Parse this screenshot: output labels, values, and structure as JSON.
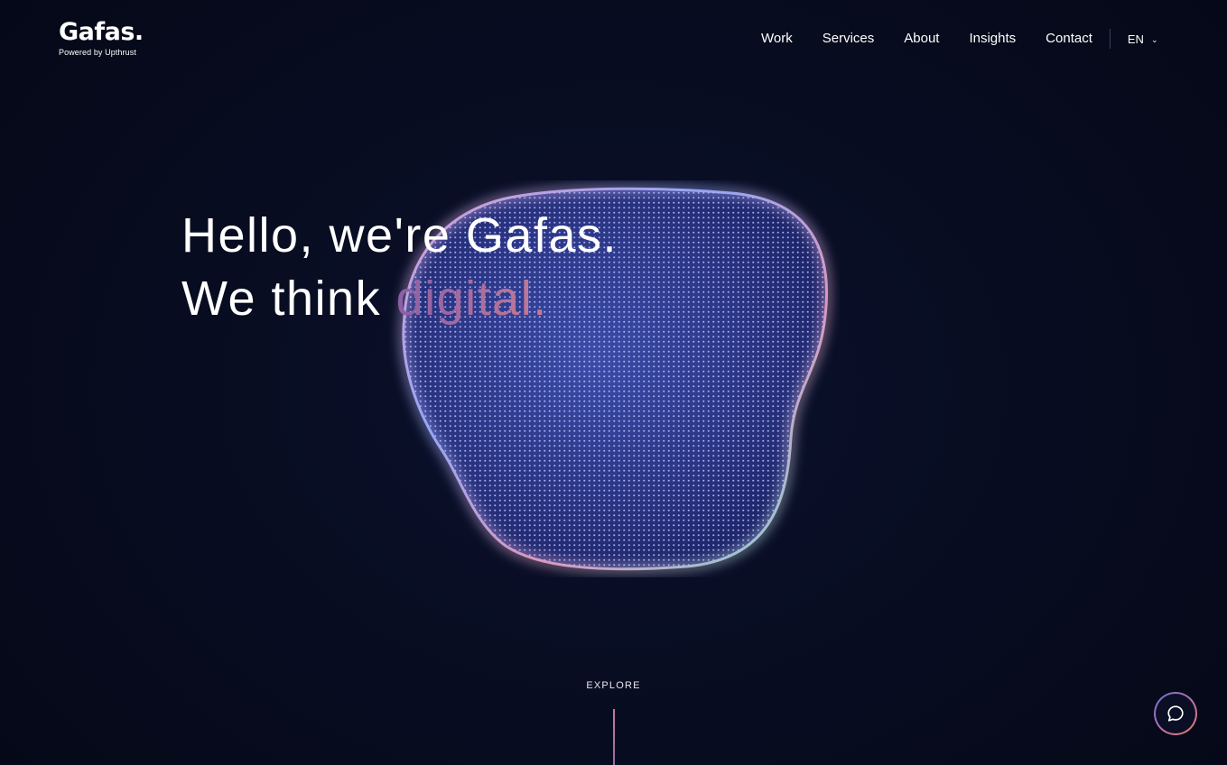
{
  "brand": {
    "name": "Gafas.",
    "tagline": "Powered by Upthrust"
  },
  "nav": {
    "items": [
      {
        "label": "Work"
      },
      {
        "label": "Services"
      },
      {
        "label": "About"
      },
      {
        "label": "Insights"
      },
      {
        "label": "Contact"
      }
    ],
    "language": {
      "selected": "EN",
      "icon": "chevron-down-icon"
    }
  },
  "hero": {
    "line1": "Hello, we're Gafas.",
    "line2_prefix": "We think ",
    "line2_accent": "digital."
  },
  "explore": {
    "label": "EXPLORE"
  },
  "chat": {
    "icon": "chat-bubble-icon"
  },
  "colors": {
    "background": "#070b1c",
    "accent_start": "#8a5fa8",
    "accent_end": "#c47c93",
    "blob_primary": "#5b6fd6",
    "blob_edge_pink": "#e0a0d0",
    "blob_edge_cyan": "#8ee0e0"
  }
}
